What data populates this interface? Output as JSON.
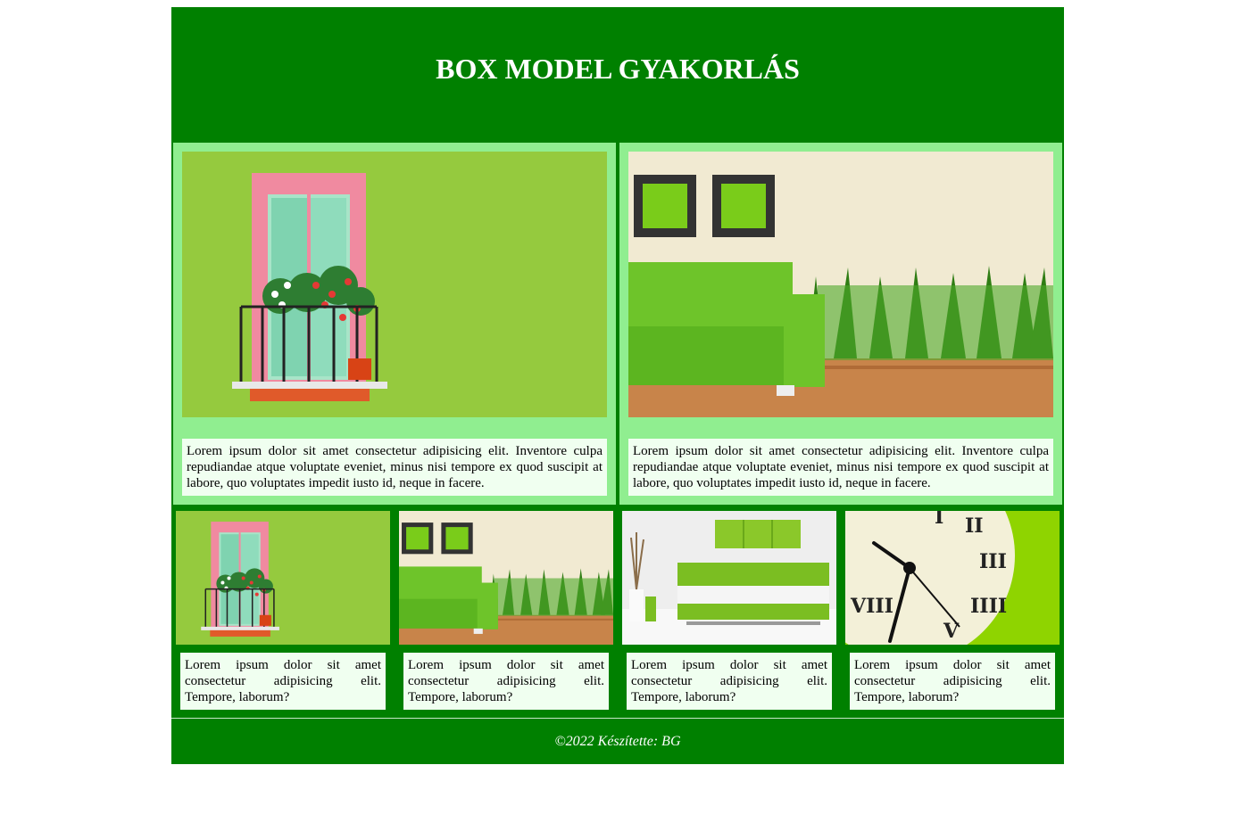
{
  "header": {
    "title": "BOX MODEL GYAKORLÁS"
  },
  "featured": [
    {
      "image": "green-wall-balcony-photo",
      "text": "Lorem ipsum dolor sit amet consectetur adipisicing elit. Inventore culpa repudiandae atque voluptate eveniet, minus nisi tempore ex quod suscipit at labore, quo voluptates impedit iusto id, neque in facere."
    },
    {
      "image": "green-sofa-grass-photo",
      "text": "Lorem ipsum dolor sit amet consectetur adipisicing elit. Inventore culpa repudiandae atque voluptate eveniet, minus nisi tempore ex quod suscipit at labore, quo voluptates impedit iusto id, neque in facere."
    }
  ],
  "cards": [
    {
      "image": "green-wall-balcony-photo",
      "text": "Lorem ipsum dolor sit amet consectetur adipisicing elit. Tempore, laborum?"
    },
    {
      "image": "green-sofa-grass-photo",
      "text": "Lorem ipsum dolor sit amet consectetur adipisicing elit. Tempore, laborum?"
    },
    {
      "image": "white-room-green-sofa-photo",
      "text": "Lorem ipsum dolor sit amet consectetur adipisicing elit. Tempore, laborum?"
    },
    {
      "image": "wall-clock-green-photo",
      "text": "Lorem ipsum dolor sit amet consectetur adipisicing elit. Tempore, laborum?"
    }
  ],
  "footer": {
    "text": "©2022 Készítette: BG"
  },
  "colors": {
    "page_bg": "#008000",
    "featured_bg": "#90ee90",
    "text_box_bg": "#f0fff0"
  }
}
